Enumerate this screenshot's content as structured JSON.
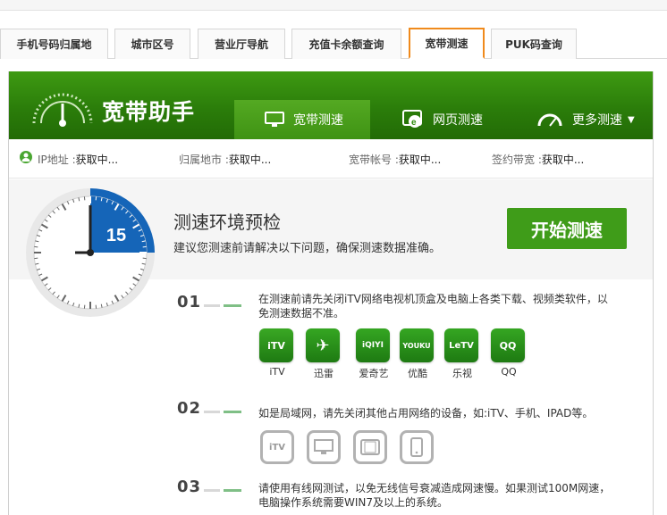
{
  "tabs": [
    {
      "label": "手机号码归属地"
    },
    {
      "label": "城市区号"
    },
    {
      "label": "营业厅导航"
    },
    {
      "label": "充值卡余额查询"
    },
    {
      "label": "宽带测速"
    },
    {
      "label": "PUK码查询"
    }
  ],
  "active_tab": "宽带测速",
  "brand": "宽带助手",
  "nav": {
    "speed_test": "宽带测速",
    "web_test": "网页测速",
    "more": "更多测速"
  },
  "info": [
    {
      "label": "IP地址 :",
      "value": "获取中..."
    },
    {
      "label": "归属地市 :",
      "value": "获取中..."
    },
    {
      "label": "宽带帐号 :",
      "value": "获取中..."
    },
    {
      "label": "签约带宽 :",
      "value": "获取中..."
    }
  ],
  "timer": {
    "value": "15"
  },
  "hero": {
    "title": "测速环境预检",
    "subtitle": "建议您测速前请解决以下问题，确保测速数据准确。",
    "start_button": "开始测速"
  },
  "steps": [
    {
      "num": "01",
      "text": "在测速前请先关闭iTV网络电视机顶盒及电脑上各类下载、视频类软件，以免测速数据不准。"
    },
    {
      "num": "02",
      "text": "如是局域网，请先关闭其他占用网络的设备，如:iTV、手机、IPAD等。"
    },
    {
      "num": "03",
      "text": "请使用有线网测试，以免无线信号衰减造成网速慢。如果测试100M网速，电脑操作系统需要WIN7及以上的系统。"
    }
  ],
  "apps": [
    {
      "label": "iTV",
      "icon": "itv-icon",
      "glyph": "iTV"
    },
    {
      "label": "迅雷",
      "icon": "xunlei-icon",
      "glyph": "✈"
    },
    {
      "label": "爱奇艺",
      "icon": "iqiyi-icon",
      "glyph": "iQIYI"
    },
    {
      "label": "优酷",
      "icon": "youku-icon",
      "glyph": "YOUKU"
    },
    {
      "label": "乐视",
      "icon": "letv-icon",
      "glyph": "LeTV"
    },
    {
      "label": "QQ",
      "icon": "qq-icon",
      "glyph": "QQ"
    }
  ],
  "devices": [
    {
      "icon": "tv-box-icon",
      "glyph": "iTV"
    },
    {
      "icon": "monitor-icon"
    },
    {
      "icon": "tablet-icon"
    },
    {
      "icon": "phone-icon"
    }
  ],
  "colors": {
    "brand_green": "#3f9c19",
    "active_tab_border": "#f08a1c",
    "timer_blue": "#1565b8"
  }
}
